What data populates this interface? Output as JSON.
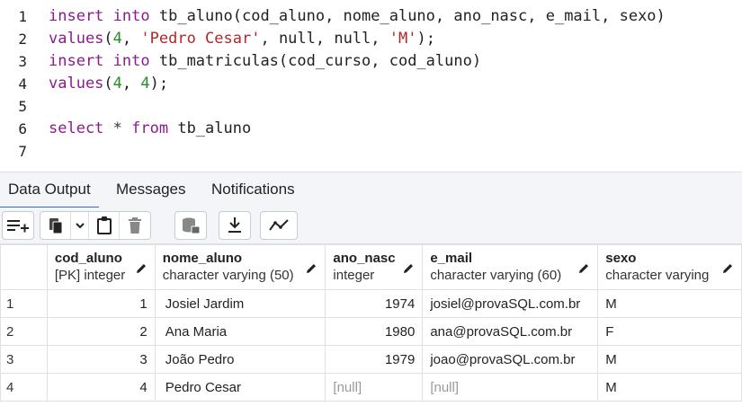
{
  "editor": {
    "line_numbers": [
      "1",
      "2",
      "3",
      "4",
      "5",
      "6",
      "7"
    ],
    "lines": [
      [
        {
          "t": "insert",
          "c": "kw"
        },
        {
          "t": " "
        },
        {
          "t": "into",
          "c": "kw"
        },
        {
          "t": " tb_aluno(cod_aluno, nome_aluno, ano_nasc, e_mail, sexo)"
        }
      ],
      [
        {
          "t": "values",
          "c": "kw"
        },
        {
          "t": "("
        },
        {
          "t": "4",
          "c": "num"
        },
        {
          "t": ", "
        },
        {
          "t": "'Pedro Cesar'",
          "c": "str"
        },
        {
          "t": ", null, null, "
        },
        {
          "t": "'M'",
          "c": "str"
        },
        {
          "t": ");"
        }
      ],
      [
        {
          "t": "insert",
          "c": "kw"
        },
        {
          "t": " "
        },
        {
          "t": "into",
          "c": "kw"
        },
        {
          "t": " tb_matriculas(cod_curso, cod_aluno)"
        }
      ],
      [
        {
          "t": "values",
          "c": "kw"
        },
        {
          "t": "("
        },
        {
          "t": "4",
          "c": "num"
        },
        {
          "t": ", "
        },
        {
          "t": "4",
          "c": "num"
        },
        {
          "t": ");"
        }
      ],
      [],
      [
        {
          "t": "select",
          "c": "kw"
        },
        {
          "t": " * ",
          "c": "op"
        },
        {
          "t": "from",
          "c": "kw"
        },
        {
          "t": " tb_aluno"
        }
      ],
      []
    ]
  },
  "tabs": {
    "data_output": "Data Output",
    "messages": "Messages",
    "notifications": "Notifications"
  },
  "toolbar": {
    "icons": [
      "add-row-icon",
      "copy-icon",
      "chevron-down-icon",
      "paste-icon",
      "delete-icon",
      "save-data-icon",
      "download-icon",
      "graph-icon"
    ]
  },
  "grid": {
    "columns": [
      {
        "name": "cod_aluno",
        "type": "[PK] integer"
      },
      {
        "name": "nome_aluno",
        "type": "character varying (50)"
      },
      {
        "name": "ano_nasc",
        "type": "integer"
      },
      {
        "name": "e_mail",
        "type": "character varying (60)"
      },
      {
        "name": "sexo",
        "type": "character varying"
      }
    ],
    "rows": [
      {
        "n": "1",
        "cells": [
          "1",
          "Josiel Jardim",
          "1974",
          "josiel@provaSQL.com.br",
          "M"
        ]
      },
      {
        "n": "2",
        "cells": [
          "2",
          "Ana Maria",
          "1980",
          "ana@provaSQL.com.br",
          "F"
        ]
      },
      {
        "n": "3",
        "cells": [
          "3",
          "João Pedro",
          "1979",
          "joao@provaSQL.com.br",
          "M"
        ]
      },
      {
        "n": "4",
        "cells": [
          "4",
          "Pedro Cesar",
          "[null]",
          "[null]",
          "M"
        ]
      }
    ]
  }
}
